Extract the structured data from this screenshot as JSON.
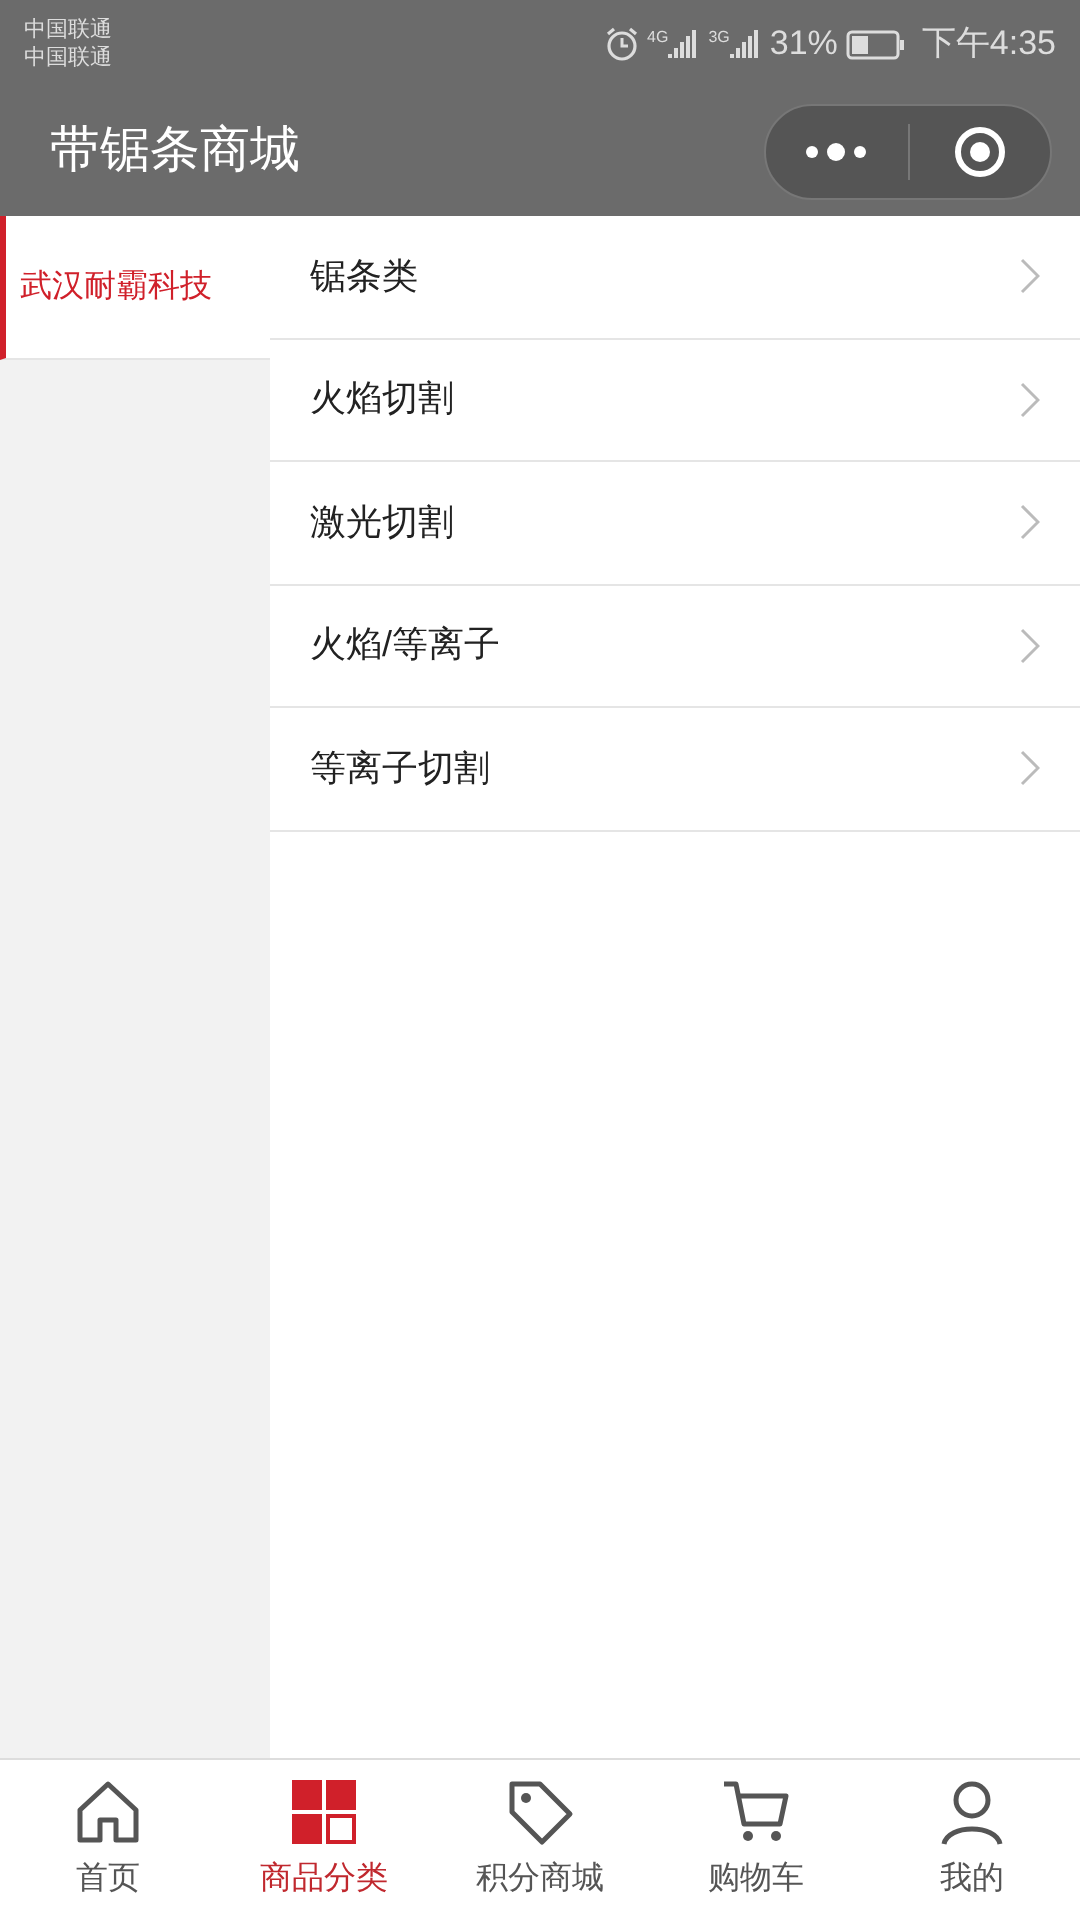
{
  "status_bar": {
    "carriers": [
      "中国联通",
      "中国联通"
    ],
    "networks": [
      "4G",
      "3G"
    ],
    "battery": "31%",
    "time": "下午4:35"
  },
  "nav": {
    "title": "带锯条商城"
  },
  "sidebar": {
    "items": [
      {
        "label": "武汉耐霸科技",
        "selected": true
      }
    ]
  },
  "categories": [
    {
      "label": "锯条类"
    },
    {
      "label": "火焰切割"
    },
    {
      "label": "激光切割"
    },
    {
      "label": "火焰/等离子"
    },
    {
      "label": "等离子切割"
    }
  ],
  "tab_bar": [
    {
      "kind": "home",
      "label": "首页",
      "selected": false
    },
    {
      "kind": "grid",
      "label": "商品分类",
      "selected": true
    },
    {
      "kind": "tag",
      "label": "积分商城",
      "selected": false
    },
    {
      "kind": "cart",
      "label": "购物车",
      "selected": false
    },
    {
      "kind": "person",
      "label": "我的",
      "selected": false
    }
  ]
}
